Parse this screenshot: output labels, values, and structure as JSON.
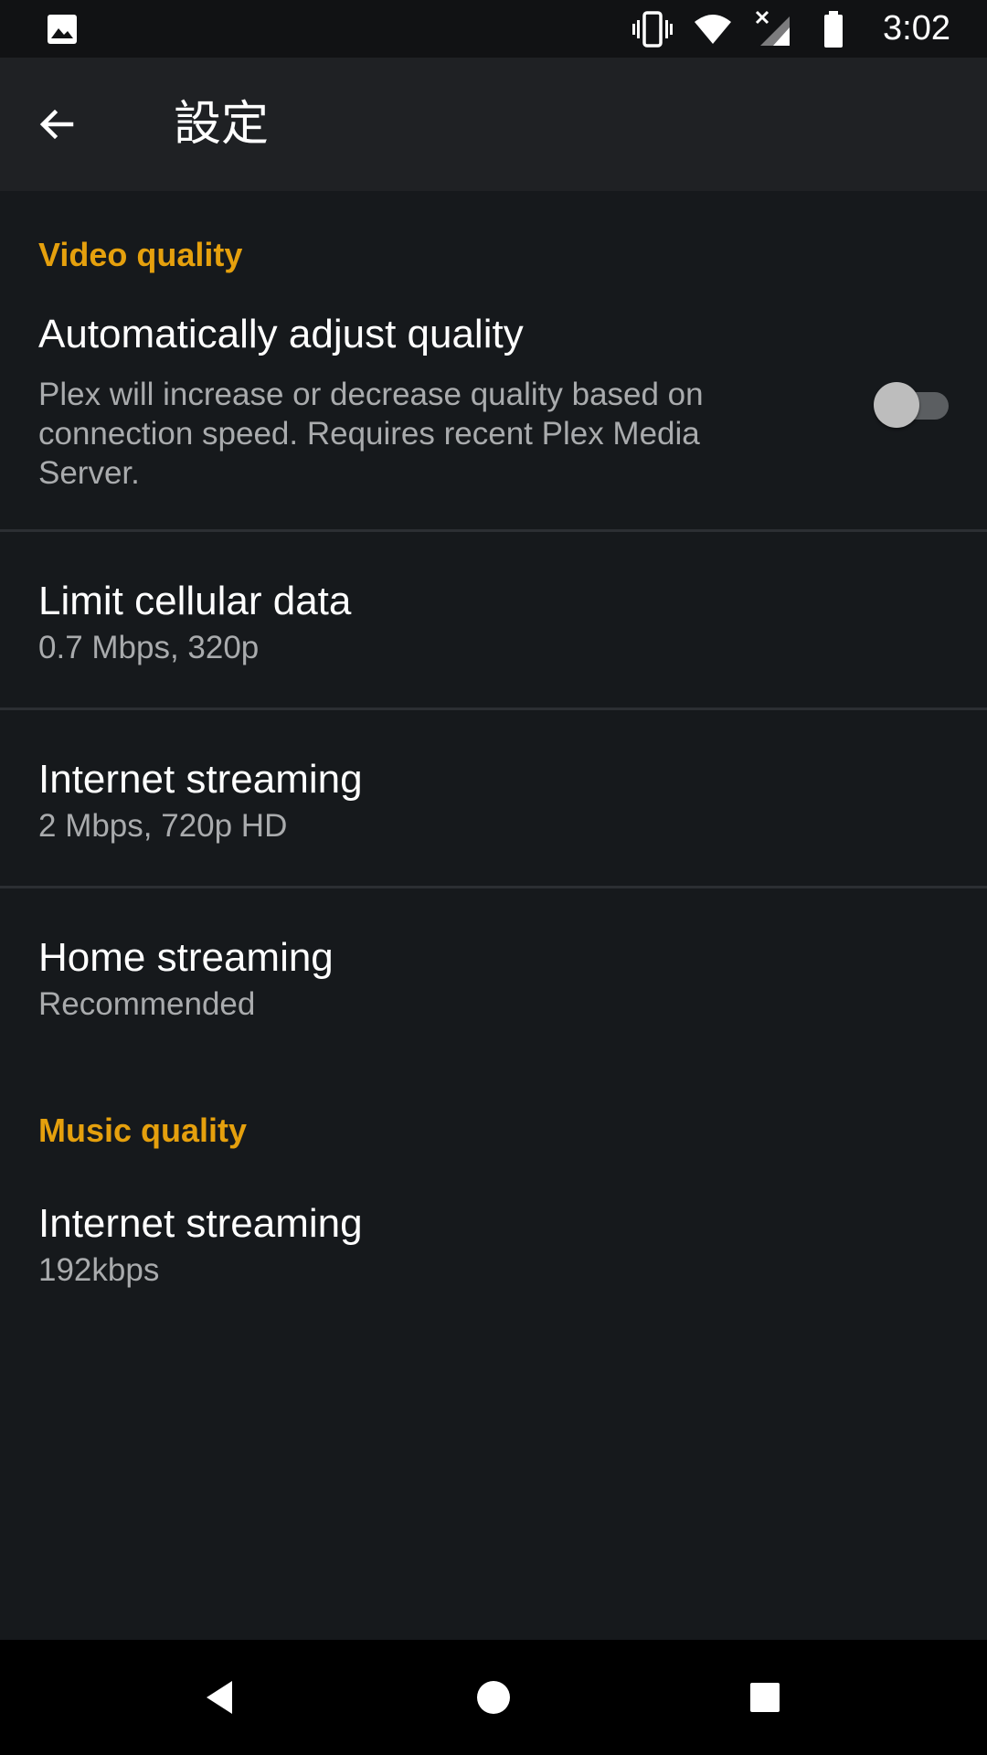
{
  "status_bar": {
    "time": "3:02",
    "left_icon": "image-notification-icon",
    "right_icons": [
      "vibrate-icon",
      "wifi-icon",
      "cellular-no-signal-icon",
      "battery-icon"
    ]
  },
  "app_bar": {
    "title": "設定",
    "back_icon": "arrow-back-icon"
  },
  "sections": [
    {
      "header": "Video quality",
      "items": [
        {
          "title": "Automatically adjust quality",
          "summary": "Plex will increase or decrease quality based on connection speed. Requires recent Plex Media Server.",
          "toggle": false
        },
        {
          "title": "Limit cellular data",
          "summary": "0.7 Mbps, 320p"
        },
        {
          "title": "Internet streaming",
          "summary": "2 Mbps, 720p HD"
        },
        {
          "title": "Home streaming",
          "summary": "Recommended"
        }
      ]
    },
    {
      "header": "Music quality",
      "items": [
        {
          "title": "Internet streaming",
          "summary": "192kbps"
        }
      ]
    }
  ],
  "colors": {
    "accent": "#e5a00d",
    "background": "#16191c",
    "app_bar": "#1f2124",
    "primary_text": "#ffffff",
    "secondary_text": "#a9abad"
  },
  "nav_bar": {
    "buttons": [
      "back-triangle-icon",
      "home-circle-icon",
      "recents-square-icon"
    ]
  }
}
